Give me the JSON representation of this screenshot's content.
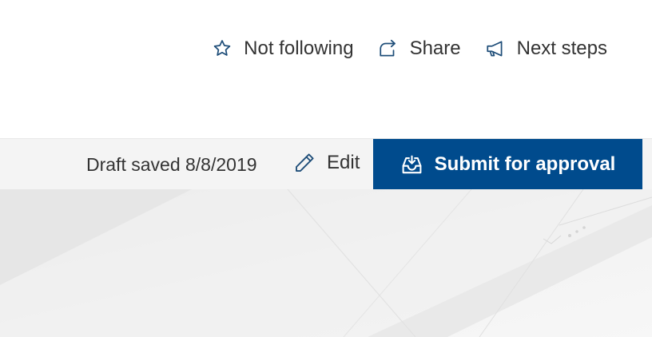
{
  "header": {
    "actions": [
      {
        "label": "Not following",
        "icon": "star-icon"
      },
      {
        "label": "Share",
        "icon": "share-icon"
      },
      {
        "label": "Next steps",
        "icon": "megaphone-icon"
      }
    ]
  },
  "command_bar": {
    "draft_status": "Draft saved 8/8/2019",
    "edit_label": "Edit",
    "submit_label": "Submit for approval"
  },
  "colors": {
    "primary": "#004b8d",
    "command_bar_bg": "#f4f4f4",
    "text": "#333333",
    "icon": "#1f4e79"
  }
}
